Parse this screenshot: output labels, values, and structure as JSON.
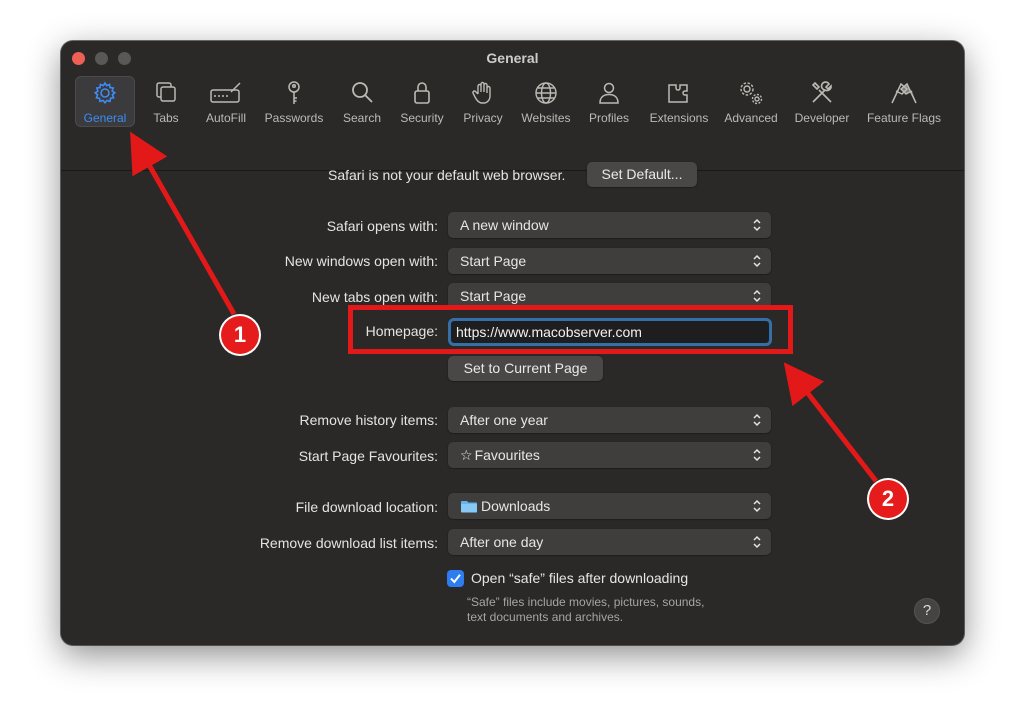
{
  "window": {
    "title": "General"
  },
  "toolbar": {
    "tabs": [
      {
        "label": "General",
        "icon": "gear-icon"
      },
      {
        "label": "Tabs",
        "icon": "tabs-icon"
      },
      {
        "label": "AutoFill",
        "icon": "autofill-icon"
      },
      {
        "label": "Passwords",
        "icon": "key-icon"
      },
      {
        "label": "Search",
        "icon": "search-icon"
      },
      {
        "label": "Security",
        "icon": "lock-icon"
      },
      {
        "label": "Privacy",
        "icon": "hand-icon"
      },
      {
        "label": "Websites",
        "icon": "globe-icon"
      },
      {
        "label": "Profiles",
        "icon": "person-icon"
      },
      {
        "label": "Extensions",
        "icon": "puzzle-icon"
      },
      {
        "label": "Advanced",
        "icon": "gears-icon"
      },
      {
        "label": "Developer",
        "icon": "tools-icon"
      },
      {
        "label": "Feature Flags",
        "icon": "flags-icon"
      }
    ],
    "active_tab": "General",
    "active_color": "#3e8cf5"
  },
  "general": {
    "default_browser_text": "Safari is not your default web browser.",
    "set_default_button": "Set Default...",
    "safari_opens_with": {
      "label": "Safari opens with:",
      "value": "A new window"
    },
    "new_windows_open_with": {
      "label": "New windows open with:",
      "value": "Start Page"
    },
    "new_tabs_open_with": {
      "label": "New tabs open with:",
      "value": "Start Page"
    },
    "homepage": {
      "label": "Homepage:",
      "value": "https://www.macobserver.com"
    },
    "set_current_page_button": "Set to Current Page",
    "remove_history_items": {
      "label": "Remove history items:",
      "value": "After one year"
    },
    "start_page_favourites": {
      "label": "Start Page Favourites:",
      "value": "Favourites"
    },
    "file_download_location": {
      "label": "File download location:",
      "value": "Downloads"
    },
    "remove_download_list_items": {
      "label": "Remove download list items:",
      "value": "After one day"
    },
    "open_safe_files": {
      "label": "Open “safe” files after downloading",
      "checked": true,
      "note_line1": "“Safe” files include movies, pictures, sounds,",
      "note_line2": "text documents and archives."
    },
    "help_button": "?"
  },
  "annotations": {
    "badge1": "1",
    "badge2": "2",
    "color": "#e31919"
  }
}
